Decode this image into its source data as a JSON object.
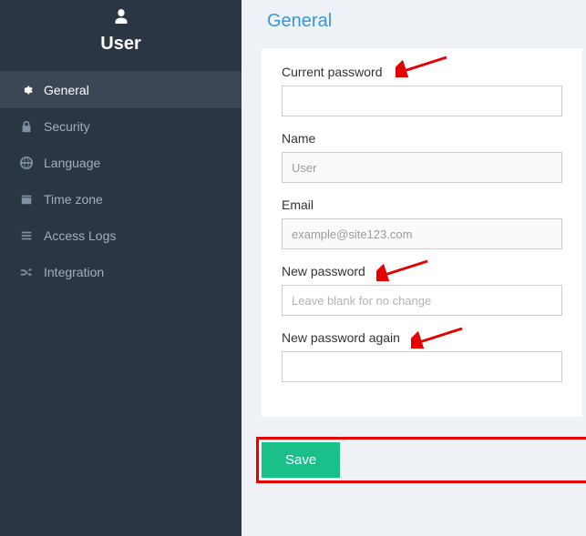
{
  "sidebar": {
    "title": "User",
    "items": [
      {
        "label": "General"
      },
      {
        "label": "Security"
      },
      {
        "label": "Language"
      },
      {
        "label": "Time zone"
      },
      {
        "label": "Access Logs"
      },
      {
        "label": "Integration"
      }
    ]
  },
  "page": {
    "title": "General"
  },
  "form": {
    "current_password": {
      "label": "Current password",
      "value": ""
    },
    "name": {
      "label": "Name",
      "value": "User"
    },
    "email": {
      "label": "Email",
      "value": "example@site123.com"
    },
    "new_password": {
      "label": "New password",
      "value": "",
      "placeholder": "Leave blank for no change"
    },
    "new_password_again": {
      "label": "New password again",
      "value": ""
    }
  },
  "actions": {
    "save_label": "Save"
  }
}
